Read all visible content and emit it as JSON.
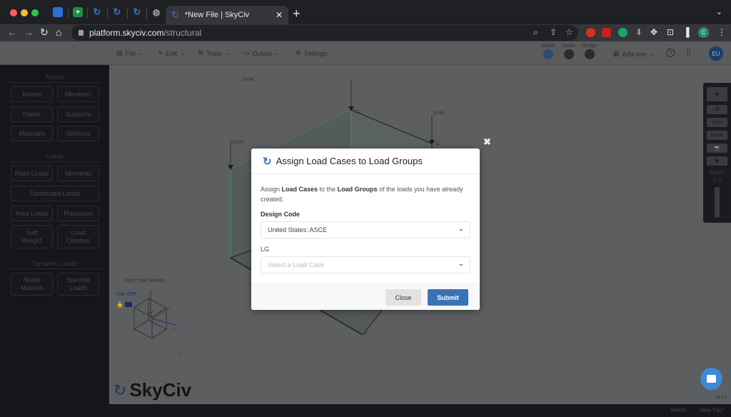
{
  "browser": {
    "pinned_tabs": [
      {
        "name": "jira-favicon",
        "color": "#2f6fd8"
      },
      {
        "name": "sheets-favicon",
        "color": "#1e8e3e"
      },
      {
        "name": "skyciv-favicon",
        "color": "#3c74c4"
      },
      {
        "name": "skyciv-favicon",
        "color": "#3c74c4"
      },
      {
        "name": "skyciv-favicon",
        "color": "#3c74c4"
      },
      {
        "name": "globe-favicon",
        "color": "#9aa0a6"
      }
    ],
    "active_tab": {
      "title": "*New File | SkyCiv",
      "close": "✕"
    },
    "new_tab": "+",
    "tab_menu": "⌄",
    "url_host": "platform.skyciv.com",
    "url_path": "/structural",
    "profile_initial": "C"
  },
  "appbar": {
    "menus": [
      {
        "icon": "file-icon",
        "glyph": "▤",
        "label": "File",
        "caret": true
      },
      {
        "icon": "pencil-icon",
        "glyph": "✎",
        "label": "Edit",
        "caret": true
      },
      {
        "icon": "wrench-icon",
        "glyph": "⚒",
        "label": "Tools",
        "caret": true
      },
      {
        "icon": "monitor-icon",
        "glyph": "▭",
        "label": "Output",
        "caret": true
      },
      {
        "icon": "gear-icon",
        "glyph": "⚙",
        "label": "Settings",
        "caret": false
      }
    ],
    "stages": [
      "Model",
      "Solve",
      "Design"
    ],
    "addons_label": "Add-ons",
    "help_glyph": "?",
    "apps_glyph": "⋮⋮⋮",
    "user_initials": "EU"
  },
  "sidebar": {
    "sections": [
      {
        "title": "Model",
        "buttons": [
          "Nodes",
          "Members",
          "Plates",
          "Supports",
          "Materials",
          "Sections"
        ]
      },
      {
        "title": "Loads",
        "buttons": [
          "Point Loads",
          "Moments",
          "Distributed Loads",
          "Area Loads",
          "Pressures",
          "Self Weight",
          "Load Combos"
        ]
      },
      {
        "title": "Dynamic Loads",
        "buttons": [
          "Nodal Masses",
          "Spectral Loads"
        ]
      }
    ]
  },
  "canvas": {
    "load_labels": [
      "10 kN",
      "10 kN",
      "10 kN"
    ],
    "node_labels": [
      "12",
      "11",
      "2"
    ],
    "section_info": "Sec1: Not Defined",
    "sw_status": "SW: OFF",
    "axes": {
      "y": "+Y",
      "x": "+X",
      "z": "+Z"
    },
    "logo_text": "SkyCiv",
    "version": "v6.0.1"
  },
  "right_panel": {
    "buttons": [
      "+",
      "👁",
      "Views",
      "Rotate",
      "📷",
      "⬢"
    ],
    "scale_label": "Scale:",
    "scale_value": "1.0"
  },
  "modal": {
    "title": "Assign Load Cases to Load Groups",
    "description_parts": [
      "Assign ",
      "Load Cases",
      " to the ",
      "Load Groups",
      " of the loads you have already created."
    ],
    "design_code_label": "Design Code",
    "design_code_value": "United States: ASCE",
    "lg_label": "LG",
    "lg_placeholder": "Select a Load Case",
    "close_label": "Close",
    "submit_label": "Submit",
    "dismiss_glyph": "✖"
  },
  "statusbar": {
    "units": "Metric",
    "file": "New File*"
  },
  "colors": {
    "accent": "#3a72b8",
    "chat": "#3f88d6"
  }
}
